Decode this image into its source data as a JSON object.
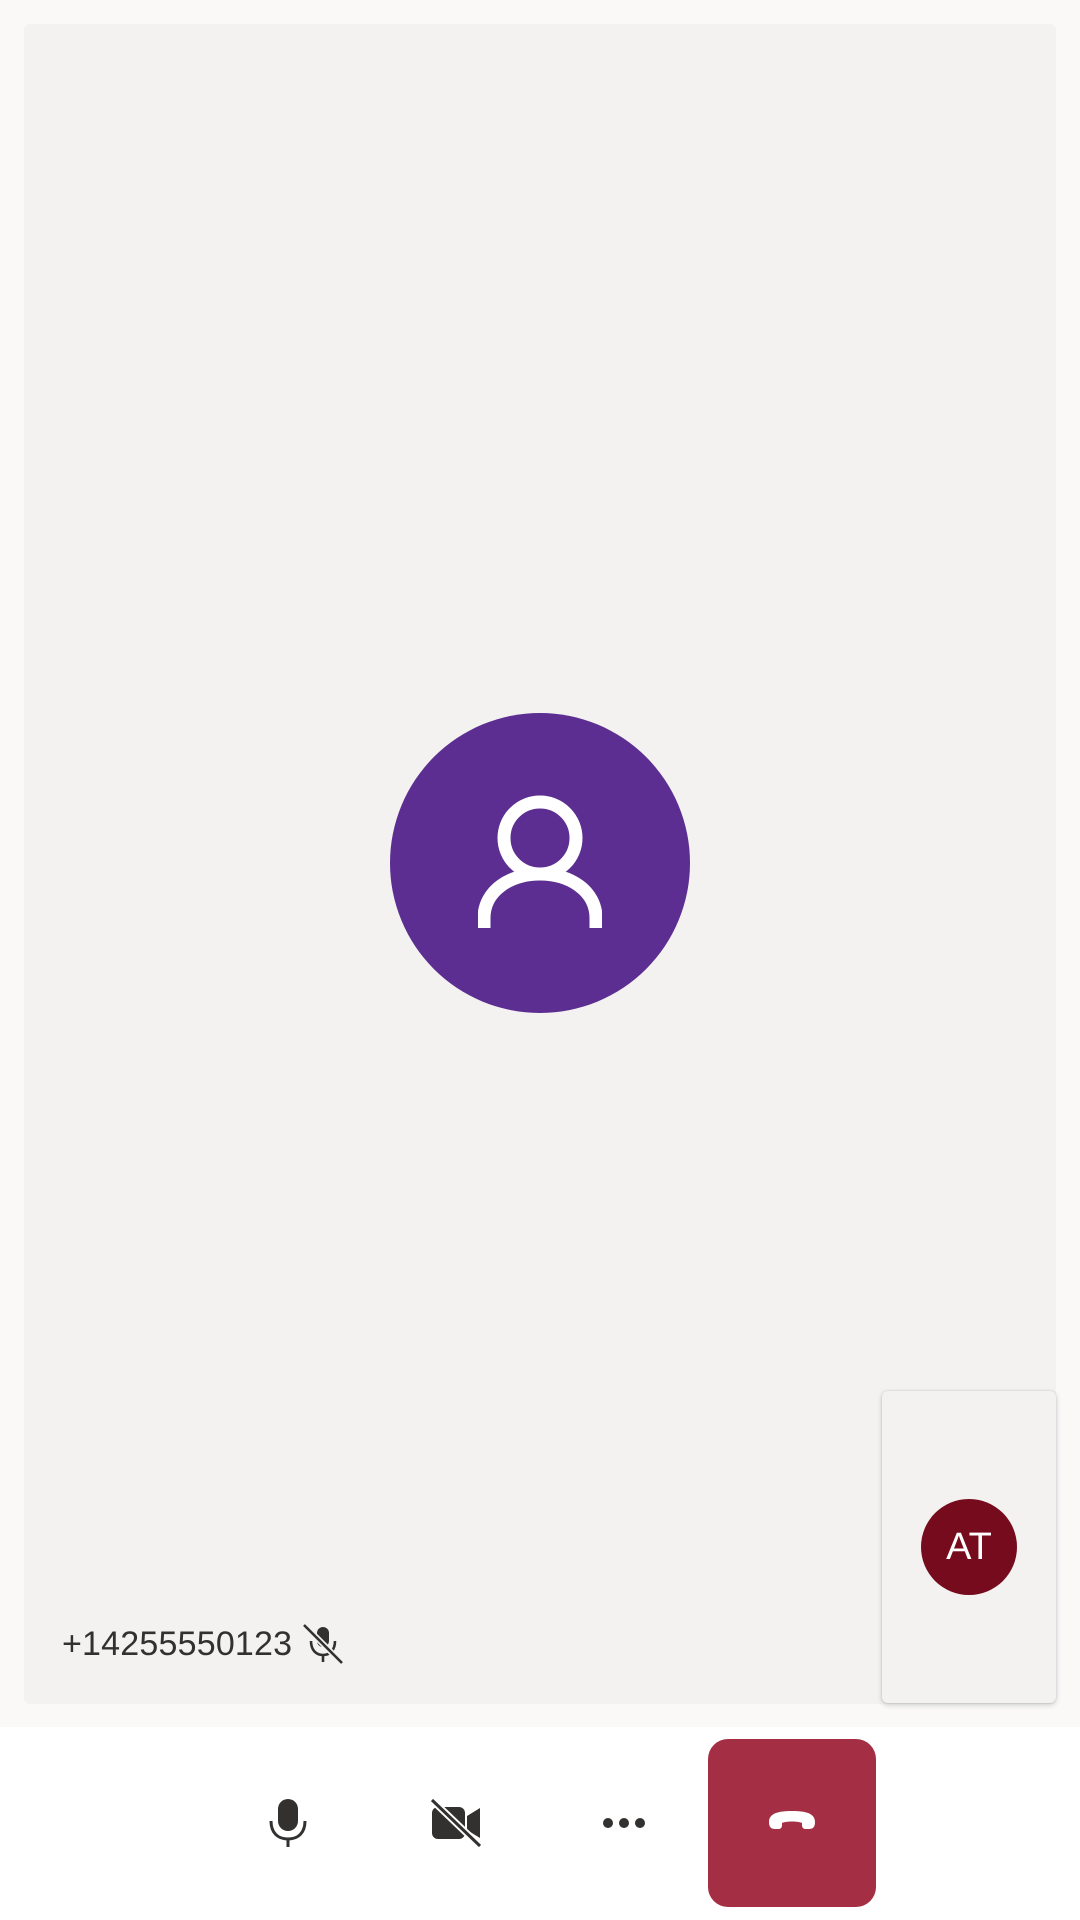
{
  "call": {
    "remote_participant": {
      "display_name": "+14255550123",
      "avatar_icon": "person-icon",
      "avatar_color": "#5c2e91",
      "mic_status_icon": "mic-off-icon"
    },
    "local_participant": {
      "initials": "AT",
      "avatar_color": "#750b1c"
    }
  },
  "controls": {
    "microphone": {
      "icon": "mic-icon"
    },
    "camera": {
      "icon": "video-off-icon"
    },
    "more": {
      "icon": "more-horizontal-icon"
    },
    "end_call": {
      "icon": "phone-hangup-icon",
      "color": "#a42e43"
    }
  }
}
